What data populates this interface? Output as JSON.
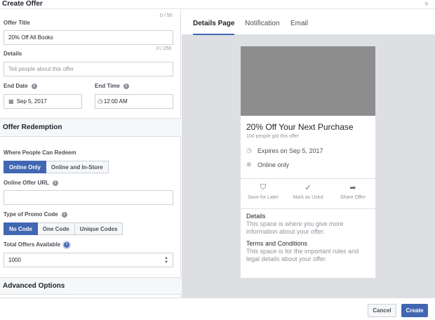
{
  "dialog": {
    "title": "Create Offer",
    "close_glyph": "×"
  },
  "form": {
    "offer_title": {
      "label": "Offer Title",
      "counter": "0 / 50",
      "value": "20% Off All Books"
    },
    "details": {
      "label": "Details",
      "counter": "0 / 250",
      "placeholder": "Tell people about this offer"
    },
    "end_date": {
      "label": "End Date",
      "value": "Sep 5, 2017"
    },
    "end_time": {
      "label": "End Time",
      "value": "12:00 AM"
    },
    "redemption_section": "Offer Redemption",
    "where_redeem": {
      "label": "Where People Can Redeem",
      "options": [
        "Online Only",
        "Online and In-Store"
      ],
      "selected": "Online Only"
    },
    "online_url": {
      "label": "Online Offer URL",
      "value": ""
    },
    "promo_type": {
      "label": "Type of Promo Code",
      "options": [
        "No Code",
        "One Code",
        "Unique Codes"
      ],
      "selected": "No Code"
    },
    "total_offers": {
      "label": "Total Offers Available",
      "value": "1000"
    },
    "advanced_section": "Advanced Options"
  },
  "preview": {
    "tabs": [
      "Details Page",
      "Notification",
      "Email"
    ],
    "active_tab": "Details Page",
    "card": {
      "title": "20% Off Your Next Purchase",
      "subtitle": "100 people got this offer",
      "expires": "Expires on Sep 5, 2017",
      "availability": "Online only",
      "actions": [
        {
          "label": "Save for Later",
          "icon": "save-icon"
        },
        {
          "label": "Mark as Used",
          "icon": "check-icon"
        },
        {
          "label": "Share Offer",
          "icon": "share-icon"
        }
      ],
      "details_heading": "Details",
      "details_text": "This space is where you give more information about your offer.",
      "terms_heading": "Terms and Conditions",
      "terms_text": "This space is for the important rules and legal details about your offer."
    }
  },
  "footer": {
    "cancel": "Cancel",
    "create": "Create"
  },
  "colors": {
    "accent": "#4267b2",
    "preview_bg": "#dddfe2",
    "cover": "#8d8d8d"
  }
}
